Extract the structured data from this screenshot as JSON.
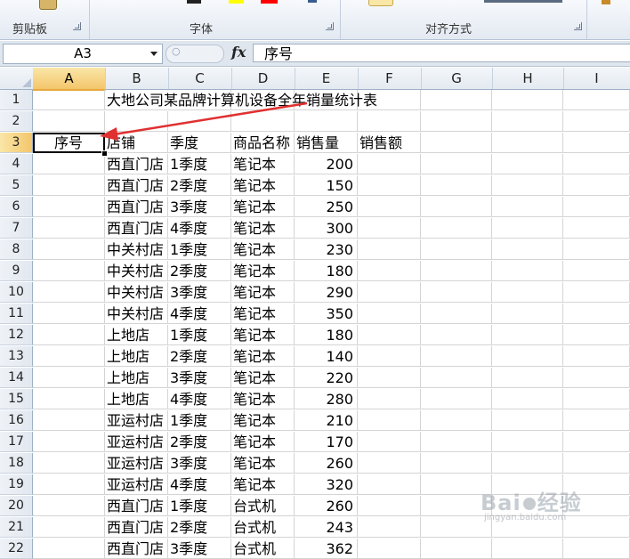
{
  "ribbon": {
    "groups": [
      {
        "label": "剪贴板"
      },
      {
        "label": "字体"
      },
      {
        "label": "对齐方式"
      }
    ],
    "font_color_swatch": "#ff0000",
    "highlight_swatch": "#ffff00"
  },
  "formula_bar": {
    "name_box": "A3",
    "fx_label": "fx",
    "formula": "序号"
  },
  "columns": [
    "A",
    "B",
    "C",
    "D",
    "E",
    "F",
    "G",
    "H",
    "I"
  ],
  "active_column": "A",
  "active_row": "3",
  "title": "大地公司某品牌计算机设备全年销量统计表",
  "headers": {
    "seq": "序号",
    "store": "店铺",
    "quarter": "季度",
    "product": "商品名称",
    "qty": "销售量",
    "amount": "销售额"
  },
  "rows": [
    {
      "row": "4",
      "store": "西直门店",
      "quarter": "1季度",
      "product": "笔记本",
      "qty": "200"
    },
    {
      "row": "5",
      "store": "西直门店",
      "quarter": "2季度",
      "product": "笔记本",
      "qty": "150"
    },
    {
      "row": "6",
      "store": "西直门店",
      "quarter": "3季度",
      "product": "笔记本",
      "qty": "250"
    },
    {
      "row": "7",
      "store": "西直门店",
      "quarter": "4季度",
      "product": "笔记本",
      "qty": "300"
    },
    {
      "row": "8",
      "store": "中关村店",
      "quarter": "1季度",
      "product": "笔记本",
      "qty": "230"
    },
    {
      "row": "9",
      "store": "中关村店",
      "quarter": "2季度",
      "product": "笔记本",
      "qty": "180"
    },
    {
      "row": "10",
      "store": "中关村店",
      "quarter": "3季度",
      "product": "笔记本",
      "qty": "290"
    },
    {
      "row": "11",
      "store": "中关村店",
      "quarter": "4季度",
      "product": "笔记本",
      "qty": "350"
    },
    {
      "row": "12",
      "store": "上地店",
      "quarter": "1季度",
      "product": "笔记本",
      "qty": "180"
    },
    {
      "row": "13",
      "store": "上地店",
      "quarter": "2季度",
      "product": "笔记本",
      "qty": "140"
    },
    {
      "row": "14",
      "store": "上地店",
      "quarter": "3季度",
      "product": "笔记本",
      "qty": "220"
    },
    {
      "row": "15",
      "store": "上地店",
      "quarter": "4季度",
      "product": "笔记本",
      "qty": "280"
    },
    {
      "row": "16",
      "store": "亚运村店",
      "quarter": "1季度",
      "product": "笔记本",
      "qty": "210"
    },
    {
      "row": "17",
      "store": "亚运村店",
      "quarter": "2季度",
      "product": "笔记本",
      "qty": "170"
    },
    {
      "row": "18",
      "store": "亚运村店",
      "quarter": "3季度",
      "product": "笔记本",
      "qty": "260"
    },
    {
      "row": "19",
      "store": "亚运村店",
      "quarter": "4季度",
      "product": "笔记本",
      "qty": "320"
    },
    {
      "row": "20",
      "store": "西直门店",
      "quarter": "1季度",
      "product": "台式机",
      "qty": "260"
    },
    {
      "row": "21",
      "store": "西直门店",
      "quarter": "2季度",
      "product": "台式机",
      "qty": "243"
    },
    {
      "row": "22",
      "store": "西直门店",
      "quarter": "3季度",
      "product": "台式机",
      "qty": "362"
    }
  ],
  "watermark": {
    "logo_left": "Bai",
    "logo_right": "经验",
    "url": "jingyan.baidu.com"
  },
  "colors": {
    "annotation_arrow": "#e03030",
    "active_header": "#f4c66b",
    "grid_line": "#d4d4d4"
  }
}
